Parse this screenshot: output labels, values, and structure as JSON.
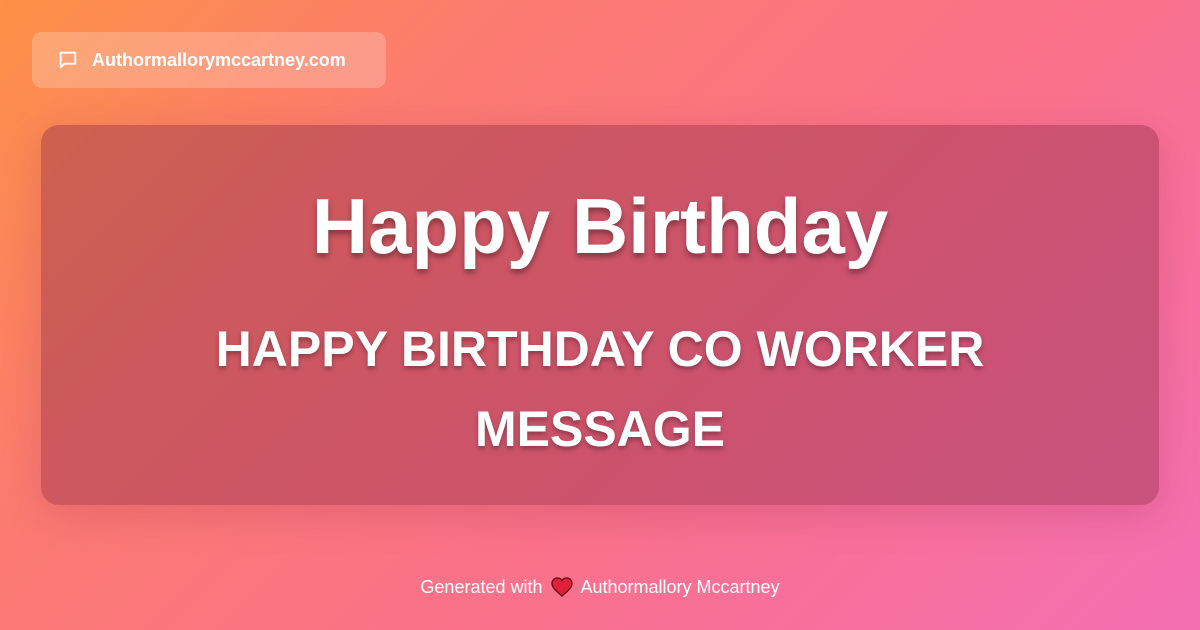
{
  "header": {
    "site_name": "Authormallorymccartney.com",
    "icon": "chat-bubble-icon"
  },
  "card": {
    "title": "Happy Birthday",
    "subtitle": "HAPPY BIRTHDAY CO WORKER MESSAGE"
  },
  "footer": {
    "generated_text": "Generated with",
    "heart_icon": "heart-icon",
    "author": "Authormallory Mccartney"
  },
  "colors": {
    "gradient_start": "#fd9146",
    "gradient_mid": "#fa718a",
    "gradient_end": "#f46fb3",
    "heart": "#e0213a"
  }
}
